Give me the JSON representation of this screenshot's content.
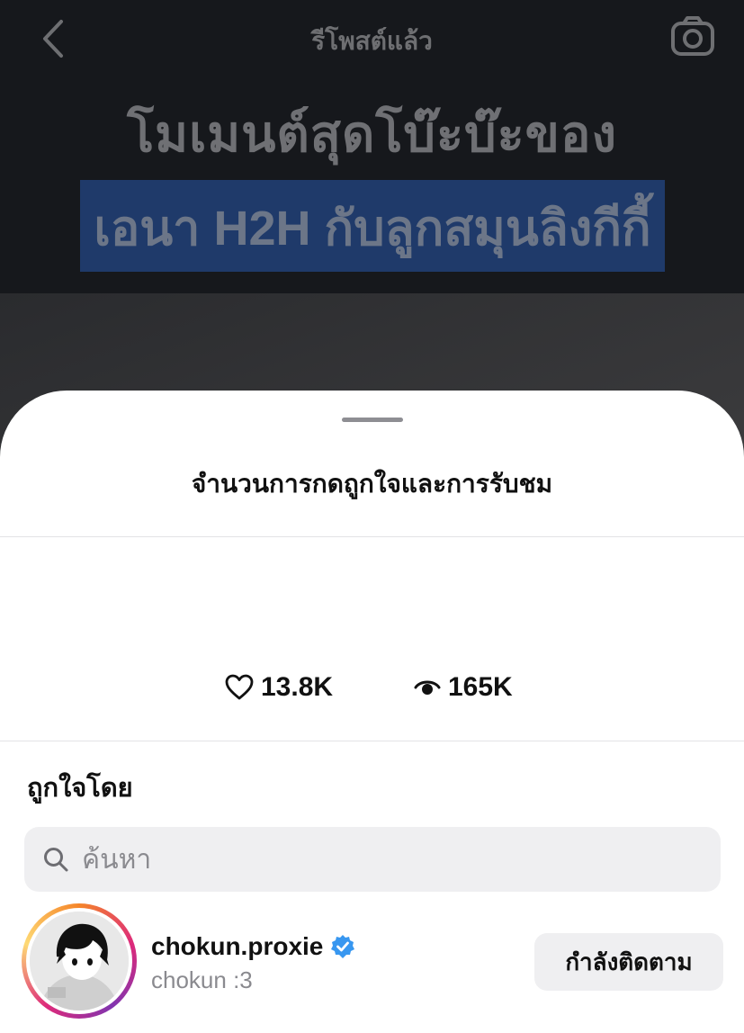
{
  "story": {
    "top_title": "รีโพสต์แล้ว",
    "headline": "โมเมนต์สุดโบ๊ะบ๊ะของ",
    "highlight": "เอนา H2H กับลูกสมุนลิงกีกี้",
    "back_icon": "chevron-left-icon",
    "camera_icon": "camera-icon"
  },
  "sheet": {
    "title": "จำนวนการกดถูกใจและการรับชม",
    "likes": "13.8K",
    "views": "165K",
    "liked_by_label": "ถูกใจโดย",
    "search_placeholder": "ค้นหา"
  },
  "users": [
    {
      "username": "chokun.proxie",
      "display_name": "chokun :3",
      "verified": true,
      "follow_label": "กำลังติดตาม"
    }
  ],
  "colors": {
    "verified": "#3897f0",
    "highlight_bg": "#1f3a6a"
  }
}
